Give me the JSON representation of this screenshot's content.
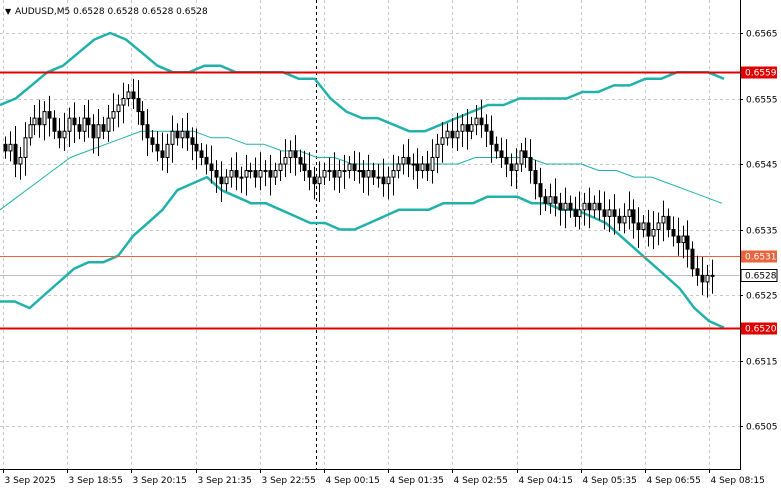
{
  "chart_data": {
    "type": "candlestick",
    "symbol_header": {
      "arrow": "▼",
      "text": "AUDUSD,M5  0.6528 0.6528 0.6528 0.6528",
      "symbol": "AUDUSD",
      "timeframe": "M5",
      "open": 0.6528,
      "high": 0.6528,
      "low": 0.6528,
      "close": 0.6528
    },
    "price_range": [
      0.649,
      0.657
    ],
    "y_ticks": [
      "0.6565",
      "0.6555",
      "0.6545",
      "0.6535",
      "0.6525",
      "0.6515",
      "0.6505",
      "0.6495"
    ],
    "x_ticks": [
      "3 Sep 2025",
      "3 Sep 18:55",
      "3 Sep 20:15",
      "3 Sep 21:35",
      "3 Sep 22:55",
      "4 Sep 00:15",
      "4 Sep 01:35",
      "4 Sep 02:55",
      "4 Sep 04:15",
      "4 Sep 05:35",
      "4 Sep 06:55",
      "4 Sep 08:15"
    ],
    "session_separator_label": "4 Sep 00:15",
    "horizontal_levels": [
      {
        "label": "0.6559",
        "value": 0.6559,
        "color": "#e00000",
        "style": "thick"
      },
      {
        "label": "0.6531",
        "value": 0.6531,
        "color": "#e8643c",
        "style": "thin"
      },
      {
        "label": "0.6520",
        "value": 0.652,
        "color": "#e00000",
        "style": "thick"
      }
    ],
    "current_price": {
      "label": "0.6528",
      "value": 0.6528
    },
    "closes": [
      0.6547,
      0.6548,
      0.6545,
      0.6546,
      0.6549,
      0.6551,
      0.6552,
      0.6551,
      0.6553,
      0.6552,
      0.655,
      0.6549,
      0.655,
      0.6552,
      0.6551,
      0.655,
      0.6552,
      0.6551,
      0.6549,
      0.6551,
      0.655,
      0.6552,
      0.6553,
      0.6554,
      0.6555,
      0.6556,
      0.6555,
      0.6553,
      0.6551,
      0.6549,
      0.6548,
      0.6547,
      0.6546,
      0.6548,
      0.655,
      0.6549,
      0.655,
      0.6549,
      0.6548,
      0.6547,
      0.6546,
      0.6545,
      0.6544,
      0.6543,
      0.6542,
      0.6543,
      0.6544,
      0.6543,
      0.6543,
      0.6544,
      0.6544,
      0.6543,
      0.6544,
      0.6544,
      0.6543,
      0.6544,
      0.6545,
      0.6546,
      0.6547,
      0.6546,
      0.6545,
      0.6544,
      0.6543,
      0.6542,
      0.6543,
      0.6544,
      0.6544,
      0.6543,
      0.6544,
      0.6544,
      0.6545,
      0.6544,
      0.6544,
      0.6543,
      0.6544,
      0.6543,
      0.6543,
      0.6542,
      0.6543,
      0.6544,
      0.6545,
      0.6546,
      0.6545,
      0.6545,
      0.6544,
      0.6545,
      0.6544,
      0.6546,
      0.6548,
      0.6549,
      0.655,
      0.6549,
      0.655,
      0.6551,
      0.655,
      0.6551,
      0.6552,
      0.6551,
      0.655,
      0.6548,
      0.6547,
      0.6546,
      0.6545,
      0.6544,
      0.6545,
      0.6547,
      0.6546,
      0.6544,
      0.6542,
      0.654,
      0.6539,
      0.654,
      0.6539,
      0.6538,
      0.6539,
      0.6538,
      0.6537,
      0.6538,
      0.6539,
      0.6538,
      0.6539,
      0.6538,
      0.6537,
      0.6538,
      0.6537,
      0.6536,
      0.6537,
      0.6538,
      0.6536,
      0.6535,
      0.6536,
      0.6534,
      0.6535,
      0.6536,
      0.6537,
      0.6535,
      0.6534,
      0.6533,
      0.6534,
      0.6532,
      0.6529,
      0.6528,
      0.6527,
      0.6528,
      0.6528
    ],
    "upper_band": [
      0.6554,
      0.6555,
      0.6557,
      0.6559,
      0.656,
      0.6562,
      0.6564,
      0.6565,
      0.6564,
      0.6562,
      0.656,
      0.6559,
      0.6559,
      0.656,
      0.656,
      0.6559,
      0.6559,
      0.6559,
      0.6559,
      0.6558,
      0.6558,
      0.6555,
      0.6553,
      0.6552,
      0.6552,
      0.6551,
      0.655,
      0.655,
      0.6551,
      0.6552,
      0.6553,
      0.6554,
      0.6554,
      0.6555,
      0.6555,
      0.6555,
      0.6555,
      0.6556,
      0.6556,
      0.6557,
      0.6557,
      0.6558,
      0.6558,
      0.6559,
      0.6559,
      0.6559,
      0.6558
    ],
    "middle_band": [
      0.6538,
      0.654,
      0.6542,
      0.6544,
      0.6546,
      0.6547,
      0.6548,
      0.6549,
      0.655,
      0.655,
      0.655,
      0.655,
      0.6549,
      0.6549,
      0.6548,
      0.6548,
      0.6547,
      0.6547,
      0.6546,
      0.6546,
      0.6545,
      0.6545,
      0.6545,
      0.6545,
      0.6545,
      0.6545,
      0.6545,
      0.6546,
      0.6546,
      0.6546,
      0.6546,
      0.6545,
      0.6545,
      0.6545,
      0.6544,
      0.6544,
      0.6543,
      0.6543,
      0.6542,
      0.6541,
      0.654,
      0.6539
    ],
    "lower_band": [
      0.6524,
      0.6524,
      0.6523,
      0.6525,
      0.6527,
      0.6529,
      0.653,
      0.653,
      0.6531,
      0.6534,
      0.6536,
      0.6538,
      0.6541,
      0.6542,
      0.6543,
      0.6541,
      0.654,
      0.6539,
      0.6539,
      0.6538,
      0.6537,
      0.6536,
      0.6536,
      0.6535,
      0.6535,
      0.6536,
      0.6537,
      0.6538,
      0.6538,
      0.6538,
      0.6539,
      0.6539,
      0.6539,
      0.654,
      0.654,
      0.654,
      0.6539,
      0.6539,
      0.6538,
      0.6538,
      0.6537,
      0.6536,
      0.6534,
      0.6532,
      0.653,
      0.6528,
      0.6526,
      0.6523,
      0.6521,
      0.652
    ],
    "colors": {
      "background": "#ffffff",
      "grid": "#c8c8c8",
      "candle": "#000000",
      "bands_outer": "#20b2aa",
      "band_middle": "#20b2aa",
      "separator": "#000000",
      "current_price_line": "#c0c0c0"
    },
    "grid": true
  }
}
